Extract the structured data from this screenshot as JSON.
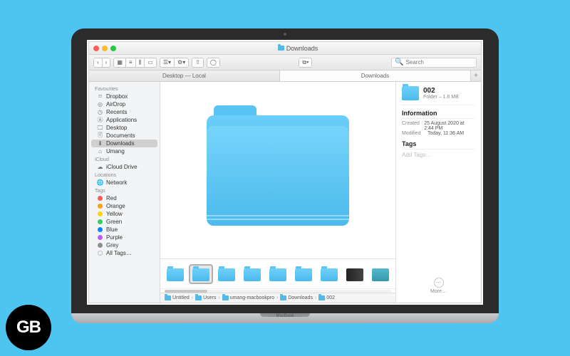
{
  "window": {
    "title": "Downloads"
  },
  "tabs": {
    "left": "Desktop — Local",
    "right": "Downloads"
  },
  "search": {
    "placeholder": "Search"
  },
  "sidebar": {
    "sections": [
      {
        "label": "Favourites",
        "items": [
          {
            "icon": "dropbox",
            "label": "Dropbox"
          },
          {
            "icon": "airdrop",
            "label": "AirDrop"
          },
          {
            "icon": "clock",
            "label": "Recents"
          },
          {
            "icon": "apps",
            "label": "Applications"
          },
          {
            "icon": "desktop",
            "label": "Desktop"
          },
          {
            "icon": "doc",
            "label": "Documents"
          },
          {
            "icon": "down",
            "label": "Downloads",
            "selected": true
          },
          {
            "icon": "home",
            "label": "Umang"
          }
        ]
      },
      {
        "label": "iCloud",
        "items": [
          {
            "icon": "cloud",
            "label": "iCloud Drive"
          }
        ]
      },
      {
        "label": "Locations",
        "items": [
          {
            "icon": "globe",
            "label": "Network"
          }
        ]
      },
      {
        "label": "Tags",
        "items": [
          {
            "tag": "#ff5b55",
            "label": "Red"
          },
          {
            "tag": "#ff9f0a",
            "label": "Orange"
          },
          {
            "tag": "#ffd60a",
            "label": "Yellow"
          },
          {
            "tag": "#30d158",
            "label": "Green"
          },
          {
            "tag": "#0a84ff",
            "label": "Blue"
          },
          {
            "tag": "#bf5af2",
            "label": "Purple"
          },
          {
            "tag": "#8e8e93",
            "label": "Grey"
          },
          {
            "tag": "",
            "label": "All Tags…"
          }
        ]
      }
    ]
  },
  "thumbs": [
    {
      "kind": "folder",
      "selected": false
    },
    {
      "kind": "folder",
      "selected": true
    },
    {
      "kind": "folder",
      "selected": false
    },
    {
      "kind": "folder",
      "selected": false
    },
    {
      "kind": "folder",
      "selected": false
    },
    {
      "kind": "folder",
      "selected": false
    },
    {
      "kind": "folder",
      "selected": false
    },
    {
      "kind": "img",
      "selected": false
    },
    {
      "kind": "img2",
      "selected": false
    }
  ],
  "path": [
    "Untitled",
    "Users",
    "umang-macbookpro",
    "Downloads",
    "002"
  ],
  "info": {
    "name": "002",
    "kind": "Folder – 1.6 MB",
    "section1": "Information",
    "created_k": "Created",
    "created_v": "25 August 2020 at 2:44 PM",
    "modified_k": "Modified",
    "modified_v": "Today, 11:36 AM",
    "section2": "Tags",
    "tags_placeholder": "Add Tags…",
    "more": "More…"
  },
  "badge": "GB",
  "laptop": "MacBook"
}
